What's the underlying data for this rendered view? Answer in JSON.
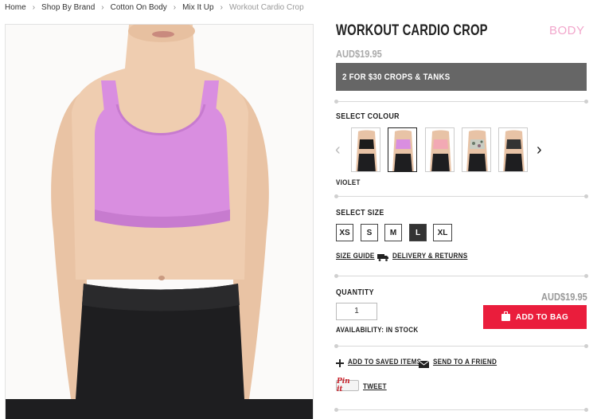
{
  "breadcrumb": [
    "Home",
    "Shop By Brand",
    "Cotton On Body",
    "Mix It Up",
    "Workout Cardio Crop"
  ],
  "brand_logo": "BODY",
  "product": {
    "title": "WORKOUT CARDIO CROP",
    "price": "AUD$19.95",
    "promo": "2 FOR $30 CROPS & TANKS"
  },
  "colour": {
    "label": "SELECT COLOUR",
    "selected_name": "VIOLET",
    "swatches": [
      "black",
      "violet",
      "pink",
      "floral",
      "charcoal"
    ]
  },
  "size": {
    "label": "SELECT SIZE",
    "options": [
      "XS",
      "S",
      "M",
      "L",
      "XL"
    ],
    "selected": "L",
    "size_guide": "SIZE GUIDE",
    "delivery": "DELIVERY & RETURNS"
  },
  "purchase": {
    "quantity_label": "QUANTITY",
    "quantity_value": "1",
    "price": "AUD$19.95",
    "add_to_bag": "ADD TO BAG",
    "availability": "AVAILABILITY:  IN STOCK"
  },
  "actions": {
    "saved": "ADD TO SAVED ITEMS",
    "friend": "SEND TO A FRIEND",
    "pinit": "Pin it",
    "tweet": "TWEET"
  },
  "colors": {
    "accent": "#ea1d3c",
    "promo_bg": "#666666",
    "logo_pink": "#f2a7cc",
    "crop_violet": "#d98ee0"
  }
}
